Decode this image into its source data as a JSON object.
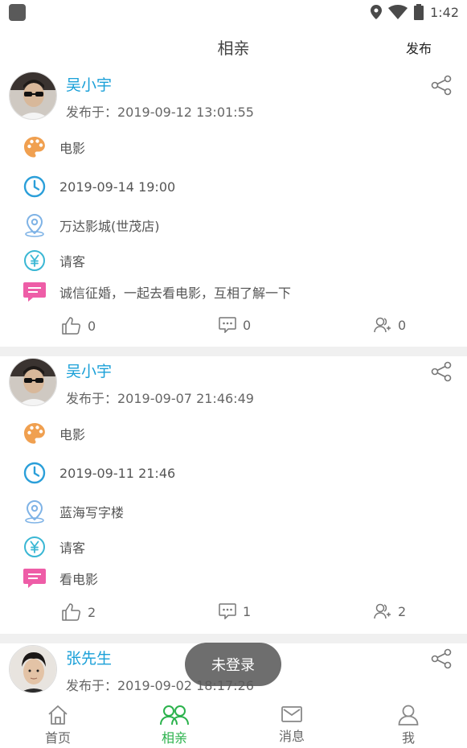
{
  "status_bar": {
    "time": "1:42"
  },
  "header": {
    "title": "相亲",
    "action": "发布"
  },
  "posts": [
    {
      "author": "吴小宇",
      "published": "发布于：2019-09-12 13:01:55",
      "category": "电影",
      "datetime": "2019-09-14 19:00",
      "location": "万达影城(世茂店)",
      "payment": "请客",
      "message": "诚信征婚，一起去看电影，互相了解一下",
      "likes": "0",
      "comments": "0",
      "participants": "0"
    },
    {
      "author": "吴小宇",
      "published": "发布于：2019-09-07 21:46:49",
      "category": "电影",
      "datetime": "2019-09-11 21:46",
      "location": "蓝海写字楼",
      "payment": "请客",
      "message": "看电影",
      "likes": "2",
      "comments": "1",
      "participants": "2"
    },
    {
      "author": "张先生",
      "published": "发布于：2019-09-02 18:17:26"
    }
  ],
  "toast": "未登录",
  "tabs": [
    {
      "label": "首页",
      "icon": "home-icon"
    },
    {
      "label": "相亲",
      "icon": "people-icon",
      "active": true
    },
    {
      "label": "消息",
      "icon": "mail-icon"
    },
    {
      "label": "我",
      "icon": "person-icon"
    }
  ],
  "colors": {
    "accent_green": "#2bb24c",
    "author_blue": "#1aa0d8",
    "palette_orange": "#f0a050",
    "clock_blue": "#2b9fd9",
    "location_blue": "#7fb3e6",
    "yen_teal": "#3ab7d4",
    "message_pink": "#ee5da7"
  }
}
